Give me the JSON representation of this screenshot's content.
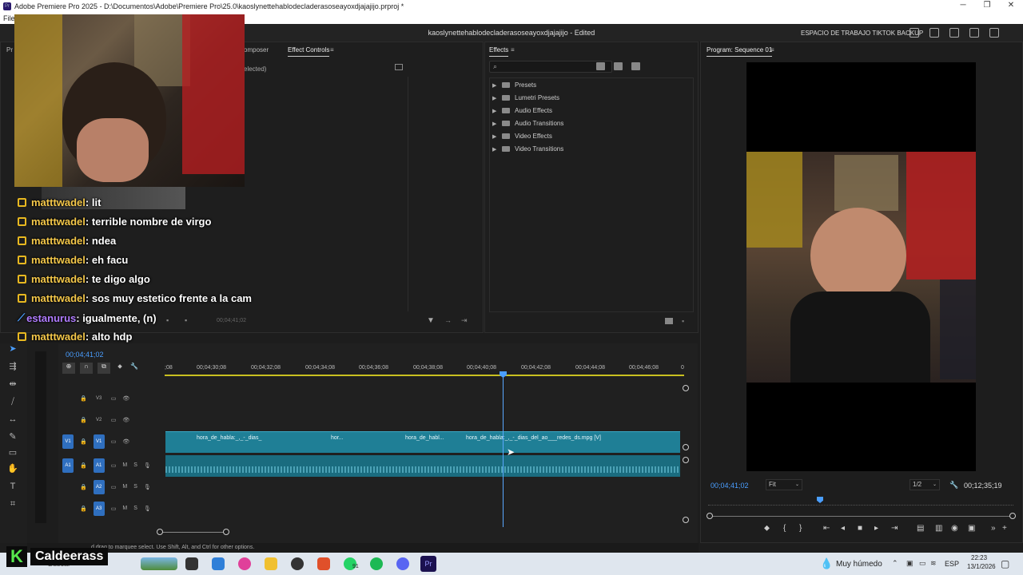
{
  "window": {
    "title": "Adobe Premiere Pro 2025 - D:\\Documentos\\Adobe\\Premiere Pro\\25.0\\kaoslynettehablodecladerasoseayoxdjajajijo.prproj *",
    "menu_first": "File",
    "controls": [
      "─",
      "❐",
      "✕"
    ]
  },
  "app_header": {
    "center_title": "kaoslynettehablodecladerasoseayoxdjajajijo - Edited",
    "workspace": "ESPACIO DE TRABAJO TIKTOK BACKUP"
  },
  "source_panel": {
    "tabs": [
      "Pr",
      "omposer",
      "Effect Controls"
    ],
    "no_clip": "elected)",
    "timecode": "00;04;41;02"
  },
  "effects_panel": {
    "tab": "Effects",
    "items": [
      "Presets",
      "Lumetri Presets",
      "Audio Effects",
      "Audio Transitions",
      "Video Effects",
      "Video Transitions"
    ]
  },
  "program": {
    "tab": "Program: Sequence 01",
    "timecode": "00;04;41;02",
    "fit": "Fit",
    "resolution": "1/2",
    "duration": "00;12;35;19"
  },
  "timeline": {
    "timecode": "00;04;41;02",
    "ruler": [
      ";08",
      "00;04;30;08",
      "00;04;32;08",
      "00;04;34;08",
      "00;04;36;08",
      "00;04;38;08",
      "00;04;40;08",
      "00;04;42;08",
      "00;04;44;08",
      "00;04;46;08",
      "0"
    ],
    "tracks": [
      {
        "id": "V3",
        "label": "V3"
      },
      {
        "id": "V2",
        "label": "V2"
      },
      {
        "id": "V1",
        "label": "V1",
        "src": "V1"
      },
      {
        "id": "A1",
        "label": "A1",
        "src": "A1"
      },
      {
        "id": "A2",
        "label": "A2"
      },
      {
        "id": "A3",
        "label": "A3"
      }
    ],
    "mute": "M",
    "solo": "S",
    "clips": [
      "hora_de_habla:_,_-_dias_",
      "hor...",
      "hora_de_habl...",
      "hora_de_habla:_,_-_dias_del_ao___redes_ds.mpg [V]"
    ]
  },
  "stream_overlay": {
    "chat": [
      {
        "user": "matttwadel",
        "msg": " : lit"
      },
      {
        "user": "matttwadel",
        "msg": " : terrible nombre de virgo"
      },
      {
        "user": "matttwadel",
        "msg": " : ndea"
      },
      {
        "user": "matttwadel",
        "msg": " : eh facu"
      },
      {
        "user": "matttwadel",
        "msg": " : te digo algo"
      },
      {
        "user": "matttwadel",
        "msg": " : sos muy estetico frente a la cam"
      },
      {
        "user": "estanurus",
        "msg": " : igualmente, (n)"
      },
      {
        "user": "matttwadel",
        "msg": " : alto hdp"
      }
    ],
    "brand": "Caldeerass",
    "brand_letter": "K"
  },
  "status": {
    "hint": "d drag to marquee select. Use Shift, Alt, and Ctrl for other options."
  },
  "taskbar": {
    "search": "Buscar",
    "whatsapp_badge": "91",
    "weather": "Muy húmedo",
    "lang": "ESP",
    "time": "22:23",
    "date": "13/1/2026"
  },
  "colors": {
    "accent": "#2f6fbf",
    "timecode": "#4a9eff",
    "clip_video": "#1f7f96",
    "clip_audio": "#1a6c7f",
    "chat_user": "#f5c84a"
  }
}
